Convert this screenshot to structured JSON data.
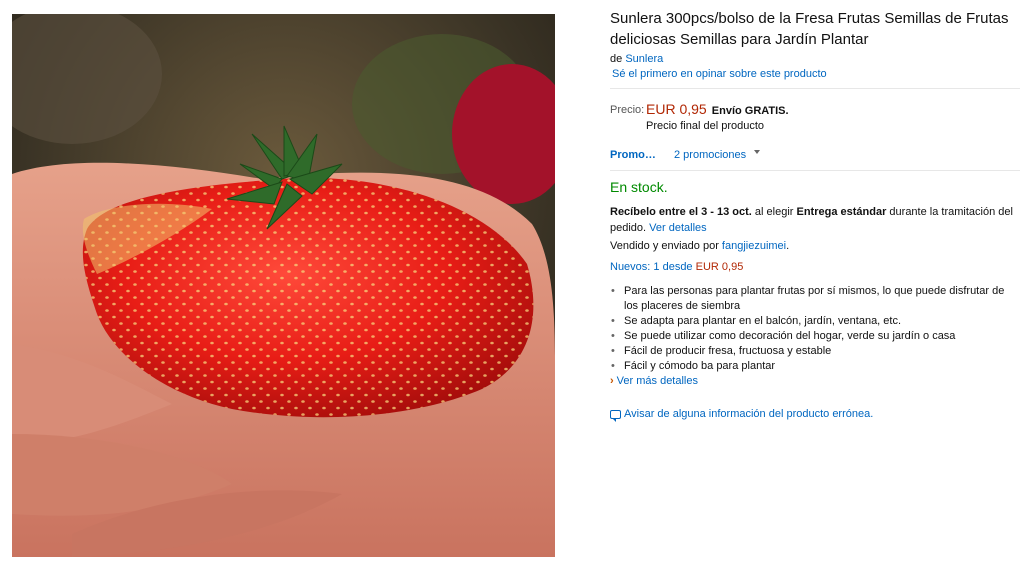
{
  "product": {
    "image_alt": "Fresa gigante en la mano",
    "title": "Sunlera 300pcs/bolso de la Fresa Frutas Semillas de Frutas deliciosas Semillas para Jardín Plantar",
    "byline_prefix": "de",
    "brand": "Sunlera",
    "review_link": "Sé el primero en opinar sobre este producto"
  },
  "price": {
    "label": "Precio:",
    "amount": "EUR 0,95",
    "shipping": "Envío GRATIS.",
    "final_note": "Precio final del producto"
  },
  "promotions": {
    "label": "Promo…",
    "count_text": "2 promociones"
  },
  "availability": {
    "stock": "En stock.",
    "delivery_prefix": "Recíbelo entre el 3 - 13 oct.",
    "delivery_mid": " al elegir ",
    "delivery_method": "Entrega estándar",
    "delivery_suffix": " durante la tramitación del pedido. ",
    "delivery_link": "Ver detalles",
    "sold_by_prefix": "Vendido y enviado por ",
    "seller": "fangjiezuimei",
    "sold_by_suffix": ".",
    "new_offers_prefix": "Nuevos: 1 desde ",
    "new_offers_price": "EUR 0,95"
  },
  "features": [
    "Para las personas para plantar frutas por sí mismos, lo que puede disfrutar de los placeres de siembra",
    "Se adapta para plantar en el balcón, jardín, ventana, etc.",
    "Se puede utilizar como decoración del hogar, verde su jardín o casa",
    "Fácil de producir fresa, fructuosa y estable",
    "Fácil y cómodo ba para plantar"
  ],
  "more_details": "Ver más detalles",
  "report_link": "Avisar de alguna información del producto errónea.",
  "icons": {
    "more_details": "chevron-right-icon",
    "report": "speech-bubble-icon",
    "promo": "caret-down-icon"
  },
  "colors": {
    "link": "#0066c0",
    "price": "#b12704",
    "stock": "#008a00"
  }
}
